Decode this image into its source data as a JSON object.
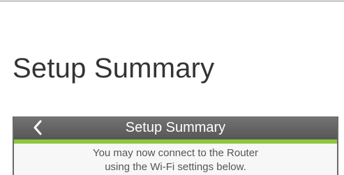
{
  "page": {
    "heading": "Setup Summary"
  },
  "app": {
    "title": "Setup Summary",
    "back_icon": "chevron-left-icon",
    "accent_color": "#8dc63f",
    "title_bar_color": "#666666"
  },
  "content": {
    "line1": "You may now connect to the Router",
    "line2": "using the Wi-Fi settings below."
  }
}
